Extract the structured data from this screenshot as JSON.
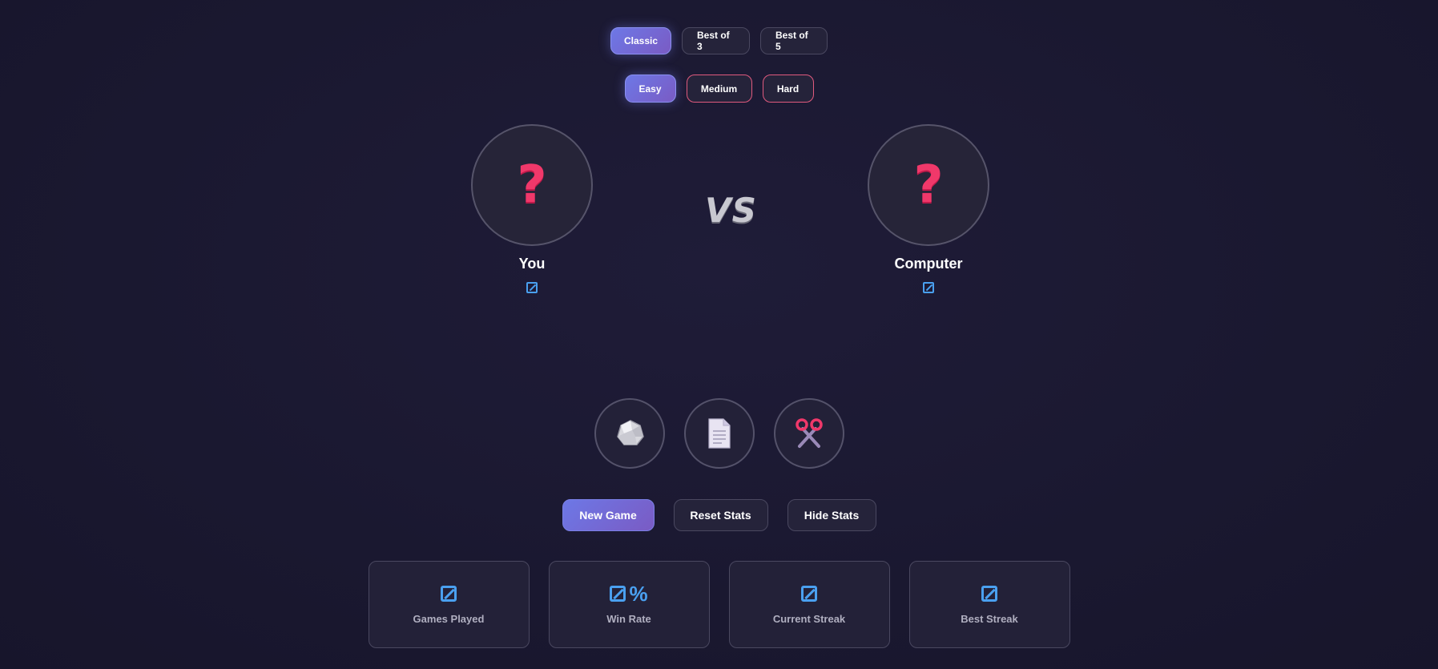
{
  "modes": [
    {
      "label": "Classic",
      "active": true
    },
    {
      "label": "Best of 3",
      "active": false
    },
    {
      "label": "Best of 5",
      "active": false
    }
  ],
  "difficulty": [
    {
      "label": "Easy",
      "active": true
    },
    {
      "label": "Medium",
      "active": false
    },
    {
      "label": "Hard",
      "active": false
    }
  ],
  "players": {
    "you": {
      "name": "You",
      "choice_icon": "question-mark-icon",
      "score_icon": "empty-score-icon"
    },
    "computer": {
      "name": "Computer",
      "choice_icon": "question-mark-icon",
      "score_icon": "empty-score-icon"
    }
  },
  "vs_label": "VS",
  "choices": [
    {
      "name": "rock",
      "icon": "rock-icon"
    },
    {
      "name": "paper",
      "icon": "paper-icon"
    },
    {
      "name": "scissors",
      "icon": "scissors-icon"
    }
  ],
  "actions": {
    "new_game": "New Game",
    "reset_stats": "Reset Stats",
    "hide_stats": "Hide Stats"
  },
  "stats": [
    {
      "label": "Games Played",
      "suffix": ""
    },
    {
      "label": "Win Rate",
      "suffix": "%"
    },
    {
      "label": "Current Streak",
      "suffix": ""
    },
    {
      "label": "Best Streak",
      "suffix": ""
    }
  ],
  "colors": {
    "accent": "#6d78e6",
    "difficulty_border": "#e05a7e",
    "question_mark": "#f0386a",
    "score_blue": "#4aa0f0"
  }
}
